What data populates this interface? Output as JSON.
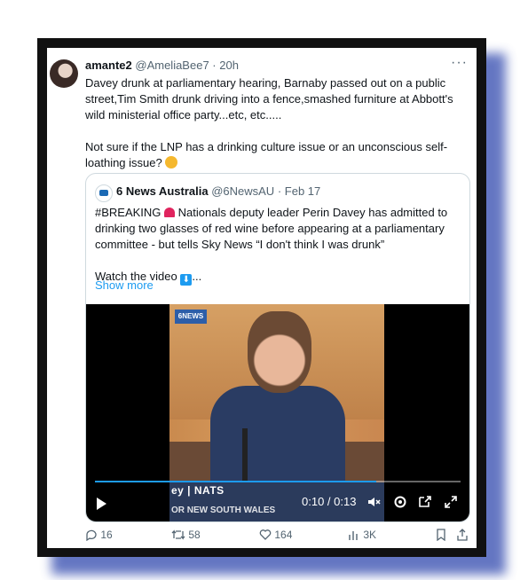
{
  "tweet": {
    "name": "amante2",
    "handle": "@AmeliaBee7",
    "separator": "·",
    "time": "20h",
    "more": "···",
    "text_1": "Davey drunk at parliamentary hearing, Barnaby passed out on a public\nstreet,Tim Smith drunk driving into a fence,smashed furniture at Abbott's\nwild ministerial office party...etc, etc.....",
    "text_2": "Not sure if the LNP has a drinking culture issue or an unconscious self-\nloathing issue?"
  },
  "quote": {
    "name": "6 News Australia",
    "handle": "@6NewsAU",
    "separator": "·",
    "time": "Feb 17",
    "text_1a": "#BREAKING",
    "text_1b": " Nationals deputy leader Perin Davey has admitted to drinking two glasses of red wine before appearing at a parliamentary committee - but tells Sky News “I don't think I was drunk”",
    "text_2": "Watch the video",
    "text_2_tail": "...",
    "show_more": "Show more",
    "down_arrow": "⬇"
  },
  "video": {
    "logo": "6NEWS",
    "lower_third": "ey | NATS",
    "lower_third_2": "OR NEW SOUTH WALES",
    "timecode": "0:10 / 0:13",
    "progress": 0.77
  },
  "actions": {
    "replies": "16",
    "retweets": "58",
    "likes": "164",
    "views": "3K"
  }
}
